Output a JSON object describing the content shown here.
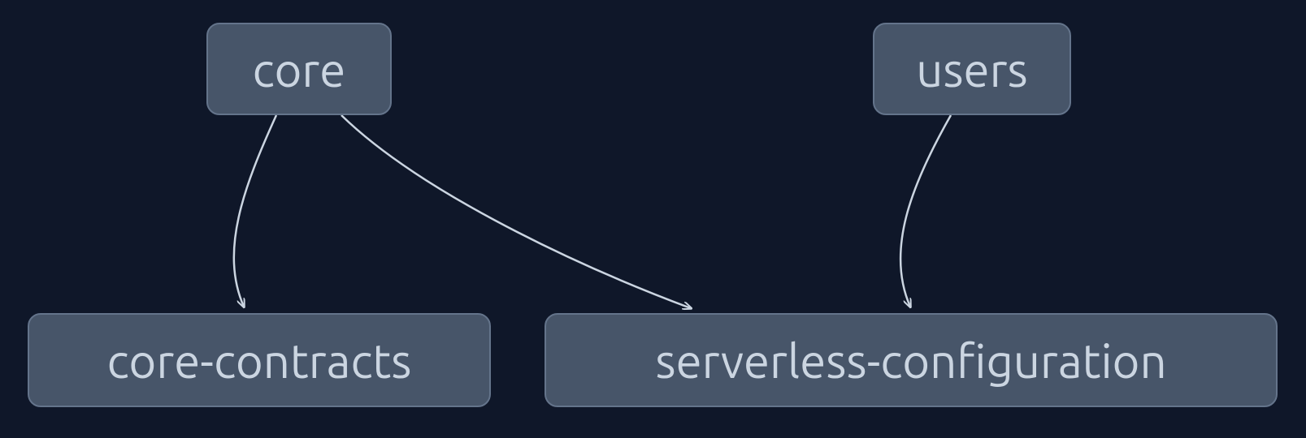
{
  "nodes": {
    "core": {
      "label": "core"
    },
    "users": {
      "label": "users"
    },
    "core_contracts": {
      "label": "core-contracts"
    },
    "serverless_configuration": {
      "label": "serverless-configuration"
    }
  },
  "edges": [
    {
      "from": "core",
      "to": "core-contracts"
    },
    {
      "from": "core",
      "to": "serverless-configuration"
    },
    {
      "from": "users",
      "to": "serverless-configuration"
    }
  ],
  "colors": {
    "background": "#0f1729",
    "node_fill": "#475569",
    "node_border": "#64748b",
    "node_text": "#cbd5e1",
    "edge": "#cbd5e1"
  }
}
